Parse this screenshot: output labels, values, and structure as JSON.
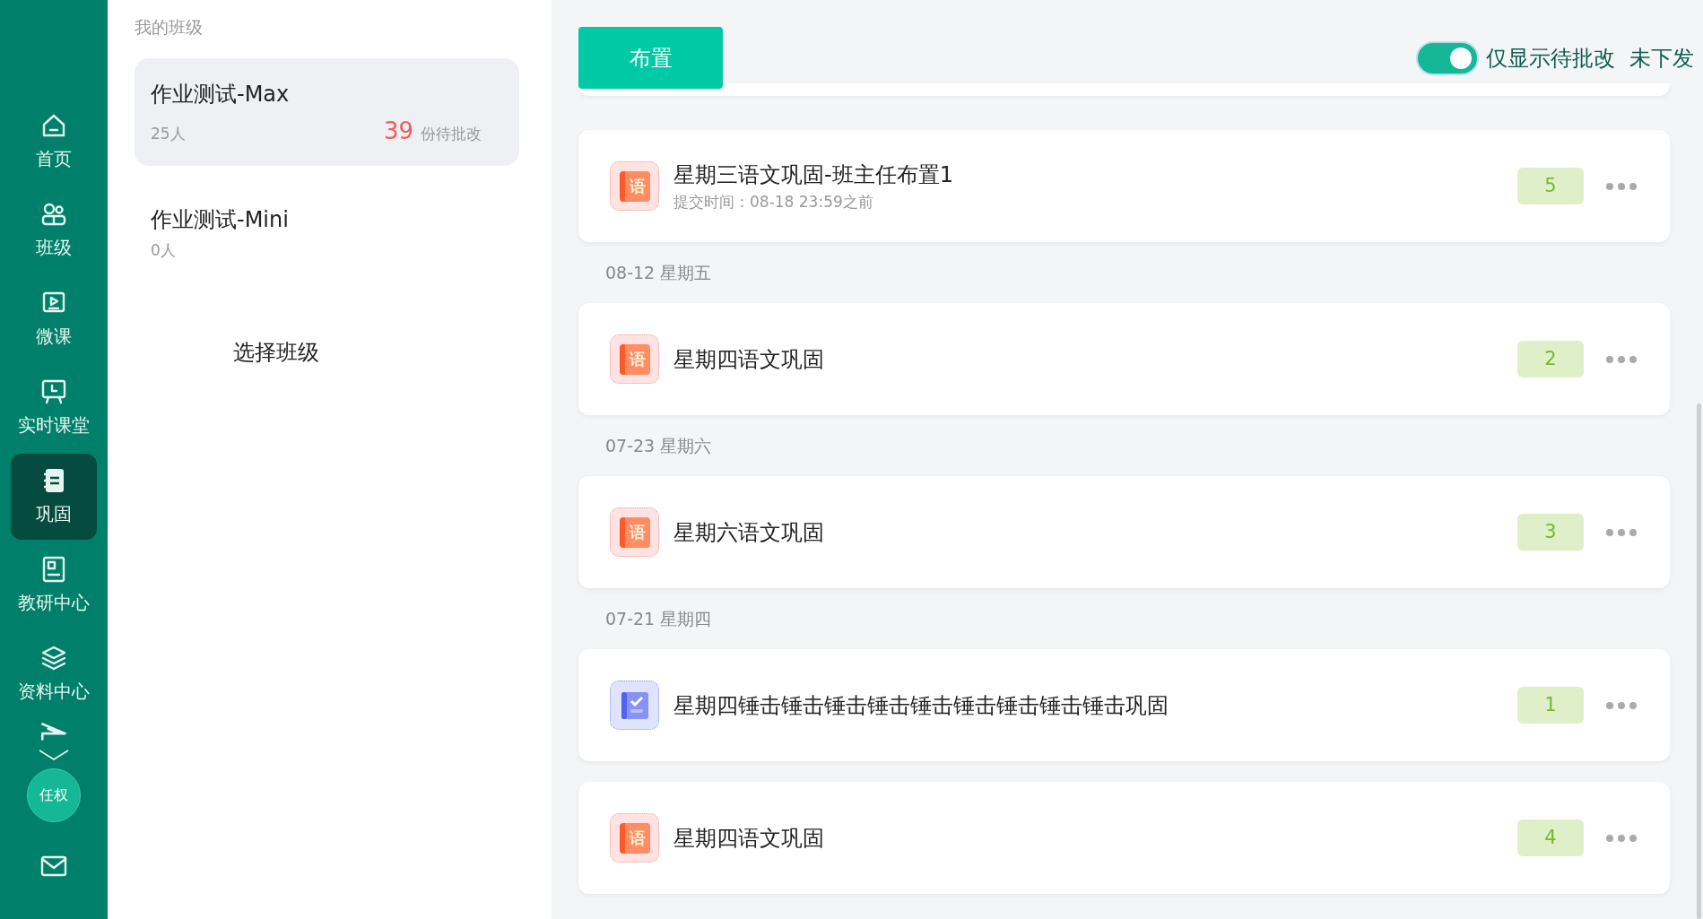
{
  "sidebar": {
    "items": [
      {
        "label": "首页",
        "selected": false
      },
      {
        "label": "班级",
        "selected": false
      },
      {
        "label": "微课",
        "selected": false
      },
      {
        "label": "实时课堂",
        "selected": false
      },
      {
        "label": "巩固",
        "selected": true
      },
      {
        "label": "教研中心",
        "selected": false
      },
      {
        "label": "资料中心",
        "selected": false
      }
    ],
    "user": {
      "name": "任权"
    }
  },
  "class_panel": {
    "title": "我的班级",
    "classes": [
      {
        "name": "作业测试-Max",
        "members": "25人",
        "pending_count": "39",
        "pending_label": "份待批改",
        "selected": true
      },
      {
        "name": "作业测试-Mini",
        "members": "0人",
        "selected": false
      }
    ],
    "select_label": "选择班级"
  },
  "toolbar": {
    "assign_button": "布置",
    "toggle": {
      "on": true,
      "label": "仅显示待批改"
    },
    "unsent_link": "未下发"
  },
  "list": [
    {
      "kind": "subject",
      "icon_text": "语",
      "title": "星期三语文巩固-班主任布置1",
      "subtitle": "提交时间：08-18 23:59之前",
      "count": "5"
    },
    {
      "kind": "date",
      "label": "08-12 星期五"
    },
    {
      "kind": "subject",
      "icon_text": "语",
      "title": "星期四语文巩固",
      "count": "2"
    },
    {
      "kind": "date",
      "label": "07-23 星期六"
    },
    {
      "kind": "subject",
      "icon_text": "语",
      "title": "星期六语文巩固",
      "count": "3"
    },
    {
      "kind": "date",
      "label": "07-21 星期四"
    },
    {
      "kind": "check",
      "title": "星期四锤击锤击锤击锤击锤击锤击锤击锤击锤击巩固",
      "count": "1"
    },
    {
      "kind": "subject",
      "icon_text": "语",
      "title": "星期四语文巩固",
      "count": "4"
    }
  ]
}
